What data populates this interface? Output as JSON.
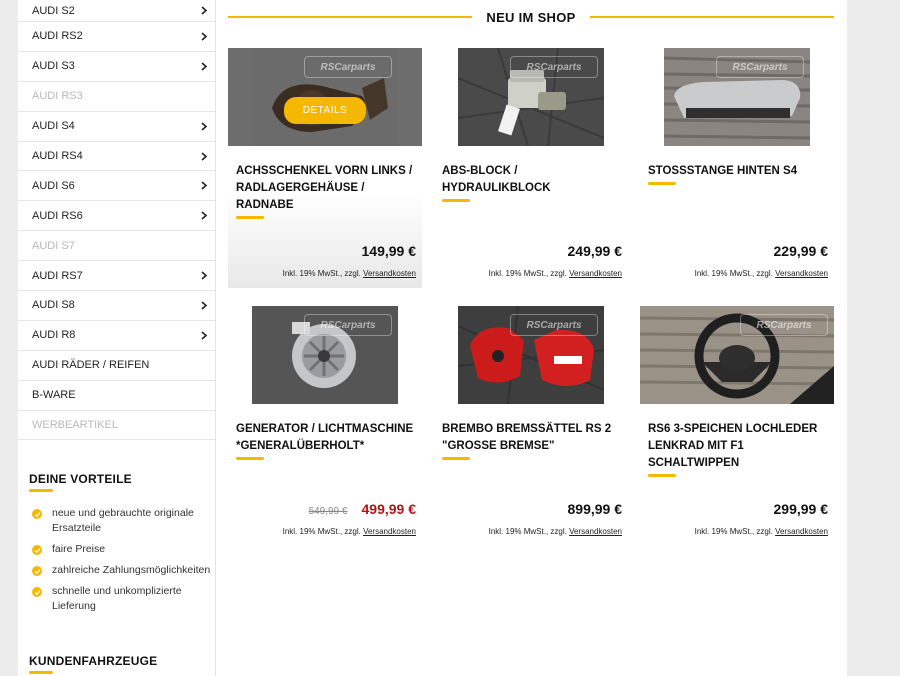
{
  "sidebar": {
    "categories": [
      {
        "label": "AUDI S2",
        "has_children": true,
        "disabled": false
      },
      {
        "label": "AUDI RS2",
        "has_children": true,
        "disabled": false
      },
      {
        "label": "AUDI S3",
        "has_children": true,
        "disabled": false
      },
      {
        "label": "AUDI RS3",
        "has_children": false,
        "disabled": true
      },
      {
        "label": "AUDI S4",
        "has_children": true,
        "disabled": false
      },
      {
        "label": "AUDI RS4",
        "has_children": true,
        "disabled": false
      },
      {
        "label": "AUDI S6",
        "has_children": true,
        "disabled": false
      },
      {
        "label": "AUDI RS6",
        "has_children": true,
        "disabled": false
      },
      {
        "label": "AUDI S7",
        "has_children": false,
        "disabled": true
      },
      {
        "label": "AUDI RS7",
        "has_children": true,
        "disabled": false
      },
      {
        "label": "AUDI S8",
        "has_children": true,
        "disabled": false
      },
      {
        "label": "AUDI R8",
        "has_children": true,
        "disabled": false
      },
      {
        "label": "AUDI RÄDER / REIFEN",
        "has_children": false,
        "disabled": false
      },
      {
        "label": "B-WARE",
        "has_children": false,
        "disabled": false
      },
      {
        "label": "WERBEARTIKEL",
        "has_children": false,
        "disabled": true
      }
    ],
    "vorteile_title": "DEINE VORTEILE",
    "vorteile": [
      "neue und gebrauchte originale Ersatzteile",
      "faire Preise",
      "zahlreiche Zahlungsmöglichkeiten",
      "schnelle und unkomplizierte Lieferung"
    ],
    "kunden_title": "KUNDENFAHRZEUGE"
  },
  "main": {
    "title": "NEU IM SHOP",
    "details_label": "DETAILS",
    "watermark": "RSCarparts",
    "tax_prefix": "Inkl. 19% MwSt., zzgl. ",
    "tax_link": "Versandkosten",
    "products": [
      {
        "title": "ACHSSCHENKEL VORN LINKS / RADLAGERGEHÄUSE / RADNABE",
        "price": "149,99 €",
        "old_price": "",
        "image": "wheel-hub-photo"
      },
      {
        "title": "ABS-BLOCK / HYDRAULIKBLOCK",
        "price": "249,99 €",
        "old_price": "",
        "image": "abs-block-photo"
      },
      {
        "title": "STOSSSTANGE HINTEN S4",
        "price": "229,99 €",
        "old_price": "",
        "image": "bumper-photo"
      },
      {
        "title": "GENERATOR / LICHTMASCHINE *GENERALÜBERHOLT*",
        "price": "499,99 €",
        "old_price": "549,99 €",
        "image": "alternator-photo"
      },
      {
        "title": "BREMBO BREMSSÄTTEL RS 2 \"GROSSE BREMSE\"",
        "price": "899,99 €",
        "old_price": "",
        "image": "brake-caliper-photo"
      },
      {
        "title": "RS6 3-SPEICHEN LOCHLEDER LENKRAD MIT F1 SCHALTWIPPEN",
        "price": "299,99 €",
        "old_price": "",
        "image": "steering-wheel-photo"
      }
    ]
  },
  "colors": {
    "accent": "#f5b800",
    "sale": "#b0141a",
    "disabled": "#b8b8b8"
  }
}
